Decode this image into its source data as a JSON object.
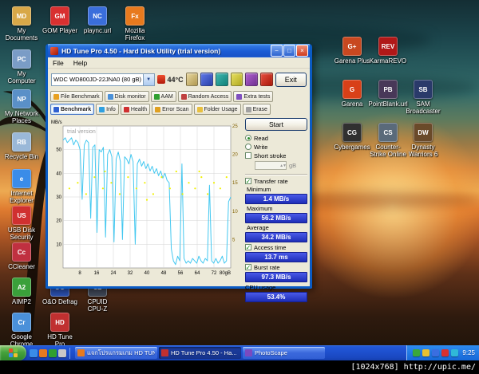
{
  "watermark": "[1024x768] http://upic.me/",
  "desktop": {
    "left_icons": [
      {
        "icon": "my-documents-icon",
        "label": "My Documents"
      },
      {
        "icon": "gom-player-icon",
        "label": "GOM Player"
      },
      {
        "icon": "plaync-icon",
        "label": "plaync.url"
      },
      {
        "icon": "mozilla-firefox-icon",
        "label": "Mozilla Firefox"
      },
      {
        "icon": "my-computer-icon",
        "label": "My Computer"
      },
      {
        "icon": "my-network-places-icon",
        "label": "My Network Places"
      },
      {
        "icon": "recycle-bin-icon",
        "label": "Recycle Bin"
      },
      {
        "icon": "internet-explorer-icon",
        "label": "Internet Explorer"
      },
      {
        "icon": "usb-disk-security-icon",
        "label": "USB Disk Security"
      },
      {
        "icon": "ccleaner-icon",
        "label": "CCleaner"
      },
      {
        "icon": "aimp2-icon",
        "label": "AIMP2"
      },
      {
        "icon": "oo-defrag-icon",
        "label": "O&O Defrag"
      },
      {
        "icon": "cpuid-cpuz-icon",
        "label": "CPUID CPU-Z"
      },
      {
        "icon": "google-chrome-icon",
        "label": "Google Chrome"
      },
      {
        "icon": "hd-tune-pro-icon",
        "label": "HD Tune Pro"
      }
    ],
    "right_icons": [
      {
        "icon": "garena-plus-icon",
        "label": "Garena Plus"
      },
      {
        "icon": "karmarevo-icon",
        "label": "KarmaREVO"
      },
      {
        "icon": "garena-icon",
        "label": "Garena"
      },
      {
        "icon": "pointblank-icon",
        "label": "PointBlank.url"
      },
      {
        "icon": "sam-broadcaster-icon",
        "label": "SAM Broadcaster"
      },
      {
        "icon": "cybergames-icon",
        "label": "Cybergames"
      },
      {
        "icon": "counter-strike-online-icon",
        "label": "Counter-Strike Online"
      },
      {
        "icon": "dynasty-warriors-6-icon",
        "label": "Dynasty Warriors 6"
      }
    ]
  },
  "window": {
    "title": "HD Tune Pro 4.50 - Hard Disk Utility (trial version)",
    "menu": [
      "File",
      "Help"
    ],
    "toolbar": {
      "drive": "WDC WD800JD-22JNA0 (80 gB)",
      "temperature": "44°C",
      "exit_label": "Exit"
    },
    "tabs_top": [
      "File Benchmark",
      "Disk monitor",
      "AAM",
      "Random Access",
      "Extra tests"
    ],
    "tabs_bottom": [
      "Benchmark",
      "Info",
      "Health",
      "Error Scan",
      "Folder Usage",
      "Erase"
    ],
    "active_tab": "Benchmark",
    "start_label": "Start",
    "options": {
      "read": "Read",
      "write": "Write",
      "short_stroke": "Short stroke",
      "gb_suffix": "gB"
    },
    "results": {
      "transfer_rate": {
        "label": "Transfer rate",
        "minimum_label": "Minimum",
        "minimum": "1.4 MB/s",
        "maximum_label": "Maximum",
        "maximum": "56.2 MB/s",
        "average_label": "Average",
        "average": "34.2 MB/s"
      },
      "access_time": {
        "label": "Access time",
        "value": "13.7 ms"
      },
      "burst_rate": {
        "label": "Burst rate",
        "value": "97.3 MB/s"
      },
      "cpu_usage": {
        "label": "CPU usage",
        "value": "53.4%"
      }
    }
  },
  "chart_data": {
    "type": "line",
    "title": "trial version",
    "left_axis": {
      "label": "MB/s",
      "min": 0,
      "max": 60,
      "ticks": [
        10,
        20,
        30,
        40,
        50
      ]
    },
    "right_axis": {
      "label": "ms",
      "min": 0,
      "max": 25,
      "ticks": [
        5,
        10,
        15,
        20,
        25
      ]
    },
    "x_axis": {
      "min": 0,
      "max": 80,
      "tick_labels": [
        "8",
        "16",
        "24",
        "32",
        "40",
        "48",
        "56",
        "64",
        "72",
        "80gB"
      ]
    },
    "series": [
      {
        "name": "Transfer rate",
        "unit": "MB/s",
        "color": "#44c8f0",
        "type": "line",
        "values": [
          54,
          55,
          53,
          54,
          55,
          52,
          54,
          53,
          50,
          29,
          52,
          54,
          53,
          21,
          51,
          52,
          15,
          50,
          49,
          51,
          13,
          48,
          50,
          47,
          11,
          46,
          49,
          45,
          12,
          47,
          46,
          44,
          48,
          45,
          10,
          44,
          46,
          43,
          45,
          42,
          44,
          41,
          43,
          40,
          42,
          39,
          41,
          38,
          40,
          37,
          36,
          8,
          3,
          1.4,
          5,
          3,
          44,
          4,
          2,
          3,
          2,
          4,
          3,
          2,
          5,
          3,
          2,
          4,
          3,
          35,
          3,
          2,
          4,
          2,
          3,
          5,
          2,
          3,
          28,
          30
        ]
      },
      {
        "name": "Access time",
        "unit": "ms",
        "color": "#f0f000",
        "type": "scatter",
        "points": [
          [
            3,
            14
          ],
          [
            7,
            15
          ],
          [
            11,
            13
          ],
          [
            15,
            16
          ],
          [
            19,
            14
          ],
          [
            20,
            17
          ],
          [
            23,
            15
          ],
          [
            27,
            13
          ],
          [
            31,
            16
          ],
          [
            35,
            14
          ],
          [
            39,
            15
          ],
          [
            40,
            12
          ],
          [
            43,
            13
          ],
          [
            47,
            16
          ],
          [
            51,
            14
          ],
          [
            54,
            17
          ],
          [
            57,
            13
          ],
          [
            60,
            15
          ],
          [
            63,
            14
          ],
          [
            65,
            17
          ],
          [
            66,
            16
          ],
          [
            69,
            13
          ],
          [
            72,
            15
          ],
          [
            75,
            14
          ],
          [
            78,
            16
          ]
        ]
      }
    ],
    "stats": {
      "minimum": "1.4 MB/s",
      "maximum": "56.2 MB/s",
      "average": "34.2 MB/s",
      "access_time": "13.7 ms",
      "burst_rate": "97.3 MB/s",
      "cpu_usage": "53.4%"
    }
  },
  "taskbar": {
    "tasks": [
      {
        "label": "แจกโปรแกรมเกม HD TUN...",
        "active": false
      },
      {
        "label": "HD Tune Pro 4.50 - Ha...",
        "active": true
      },
      {
        "label": "PhotoScape",
        "active": false
      }
    ],
    "time": "9:25"
  }
}
